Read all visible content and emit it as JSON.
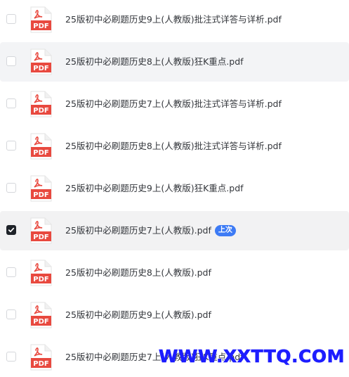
{
  "files": [
    {
      "name": "25版初中必刷题历史9上(人教版)批注式详答与详析.pdf",
      "checked": false,
      "state": "normal",
      "badge": "",
      "icon_label": "PDF"
    },
    {
      "name": "25版初中必刷题历史8上(人教版)狂K重点.pdf",
      "checked": false,
      "state": "hover",
      "badge": "",
      "icon_label": "PDF"
    },
    {
      "name": "25版初中必刷题历史7上(人教版)批注式详答与详析.pdf",
      "checked": false,
      "state": "normal",
      "badge": "",
      "icon_label": "PDF"
    },
    {
      "name": "25版初中必刷题历史8上(人教版)批注式详答与详析.pdf",
      "checked": false,
      "state": "normal",
      "badge": "",
      "icon_label": "PDF"
    },
    {
      "name": "25版初中必刷题历史9上(人教版)狂K重点.pdf",
      "checked": false,
      "state": "normal",
      "badge": "",
      "icon_label": "PDF"
    },
    {
      "name": "25版初中必刷题历史7上(人教版).pdf",
      "checked": true,
      "state": "selected",
      "badge": "上次",
      "icon_label": "PDF"
    },
    {
      "name": "25版初中必刷题历史8上(人教版).pdf",
      "checked": false,
      "state": "normal",
      "badge": "",
      "icon_label": "PDF"
    },
    {
      "name": "25版初中必刷题历史9上(人教版).pdf",
      "checked": false,
      "state": "normal",
      "badge": "",
      "icon_label": "PDF"
    },
    {
      "name": "25版初中必刷题历史7上(人教版)狂K重点.pdf",
      "checked": false,
      "state": "normal",
      "badge": "",
      "icon_label": "PDF"
    }
  ],
  "watermark": "WWW.XXTTQ.COM",
  "colors": {
    "pdf_red": "#e8493f",
    "badge_blue": "#3d7bf5",
    "watermark_blue": "#1d1dff",
    "checked_bg": "#1f2329"
  }
}
